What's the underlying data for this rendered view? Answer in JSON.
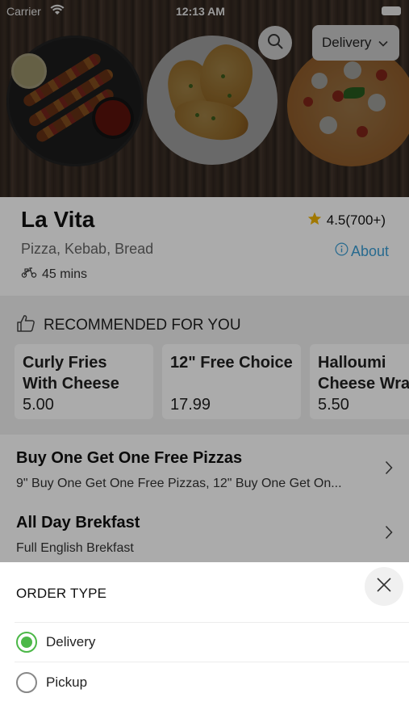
{
  "status_bar": {
    "carrier": "Carrier",
    "time": "12:13 AM"
  },
  "header": {
    "order_type_label": "Delivery"
  },
  "restaurant": {
    "name": "La Vita",
    "rating": "4.5(700+)",
    "cuisines": "Pizza, Kebab, Bread",
    "about_label": "About",
    "delivery_time": "45 mins"
  },
  "recommended": {
    "title": "RECOMMENDED FOR YOU",
    "items": [
      {
        "name": "Curly Fries\nWith Cheese",
        "price": "5.00"
      },
      {
        "name": "12\" Free Choice",
        "price": "17.99"
      },
      {
        "name": "Halloumi\nCheese Wra",
        "price": "5.50"
      }
    ]
  },
  "menu_sections": [
    {
      "title": "Buy One Get One Free Pizzas",
      "subtitle": "9\" Buy One Get One Free Pizzas, 12\" Buy One Get On..."
    },
    {
      "title": "All Day Brekfast",
      "subtitle": "Full English Brekfast"
    }
  ],
  "order_sheet": {
    "title": "ORDER TYPE",
    "options": [
      {
        "label": "Delivery",
        "selected": true
      },
      {
        "label": "Pickup",
        "selected": false
      }
    ]
  },
  "colors": {
    "accent_green": "#4cb848",
    "link_blue": "#3b9fd6",
    "star": "#f0b400"
  },
  "icons": [
    "search-icon",
    "chevron-down-icon",
    "star-icon",
    "info-icon",
    "scooter-icon",
    "thumbs-up-icon",
    "chevron-right-icon",
    "close-icon",
    "wifi-icon",
    "battery-icon"
  ]
}
